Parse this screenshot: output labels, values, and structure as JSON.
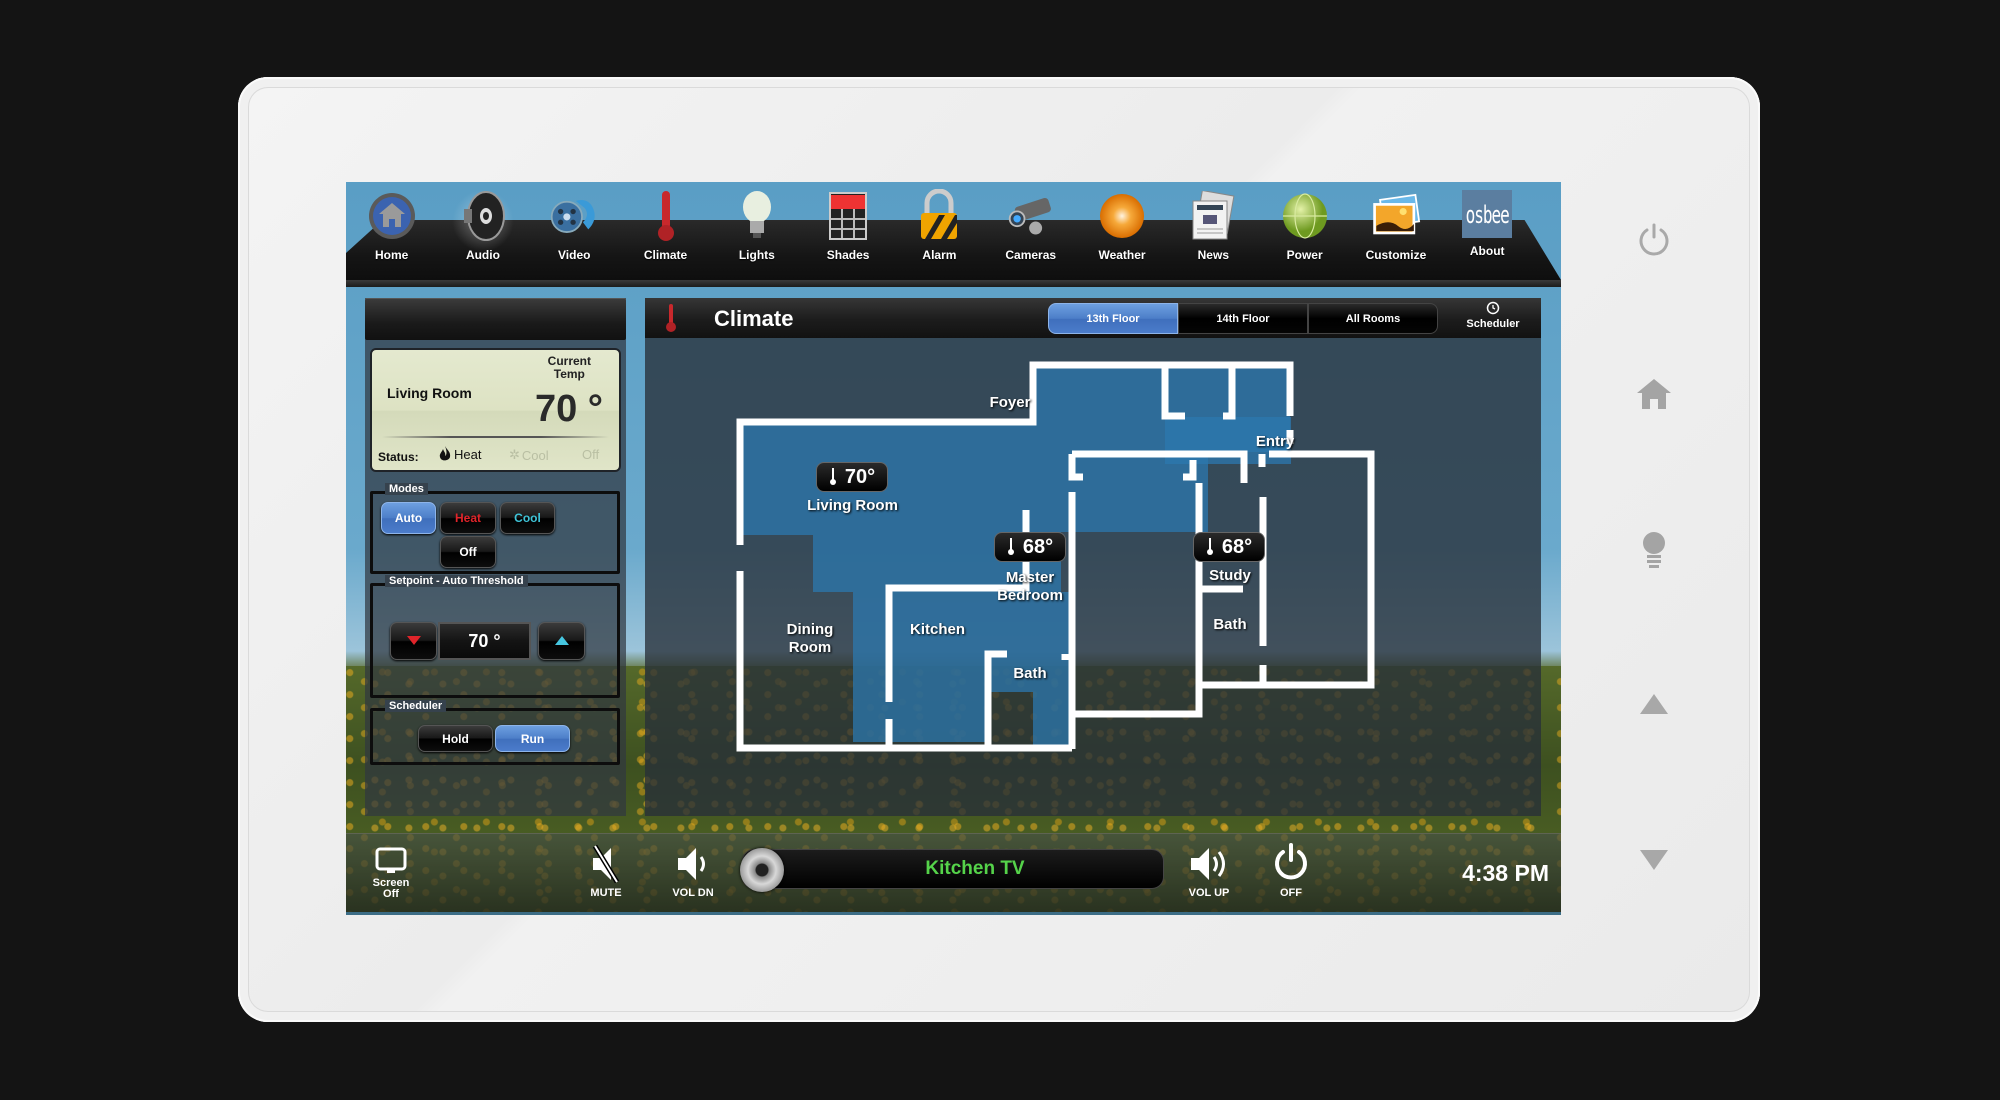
{
  "nav": {
    "items": [
      {
        "label": "Home",
        "icon": "home-icon"
      },
      {
        "label": "Audio",
        "icon": "speaker-icon"
      },
      {
        "label": "Video",
        "icon": "film-reel-icon"
      },
      {
        "label": "Climate",
        "icon": "thermometer-icon"
      },
      {
        "label": "Lights",
        "icon": "lightbulb-icon"
      },
      {
        "label": "Shades",
        "icon": "shades-icon"
      },
      {
        "label": "Alarm",
        "icon": "padlock-icon"
      },
      {
        "label": "Cameras",
        "icon": "security-camera-icon"
      },
      {
        "label": "Weather",
        "icon": "weather-sun-icon"
      },
      {
        "label": "News",
        "icon": "newspaper-icon"
      },
      {
        "label": "Power",
        "icon": "globe-icon"
      },
      {
        "label": "Customize",
        "icon": "photos-icon"
      },
      {
        "label": "About",
        "icon": "osbee-logo"
      }
    ],
    "active": "Audio",
    "logo_text": "osbee"
  },
  "thermostat": {
    "room": "Living Room",
    "current_temp_label_line1": "Current",
    "current_temp_label_line2": "Temp",
    "current_temp": "70 °",
    "status_label": "Status:",
    "status_options": [
      "Heat",
      "Cool",
      "Off"
    ],
    "status_active": "Heat"
  },
  "modes": {
    "title": "Modes",
    "buttons": [
      {
        "label": "Auto",
        "color": "#ffffff"
      },
      {
        "label": "Heat",
        "color": "#e0242a"
      },
      {
        "label": "Cool",
        "color": "#3fc4d8"
      },
      {
        "label": "Off",
        "color": "#ffffff"
      }
    ],
    "active": "Auto"
  },
  "setpoint": {
    "title": "Setpoint - Auto Threshold",
    "value": "70 °",
    "down_color": "#e0242a",
    "up_color": "#46c6e0"
  },
  "scheduler": {
    "title": "Scheduler",
    "buttons": [
      "Hold",
      "Run"
    ],
    "active": "Run"
  },
  "climate": {
    "title": "Climate",
    "floors": [
      "13th Floor",
      "14th Floor",
      "All Rooms"
    ],
    "active_floor": "13th Floor",
    "scheduler_label": "Scheduler",
    "rooms": [
      {
        "name": "Foyer"
      },
      {
        "name": "Entry"
      },
      {
        "name": "Living Room",
        "temp": "70°"
      },
      {
        "name": "Master Bedroom",
        "line1": "Master",
        "line2": "Bedroom",
        "temp": "68°"
      },
      {
        "name": "Study",
        "temp": "68°"
      },
      {
        "name": "Bath"
      },
      {
        "name": "Dining Room",
        "line1": "Dining",
        "line2": "Room"
      },
      {
        "name": "Kitchen"
      },
      {
        "name": "Bath"
      }
    ]
  },
  "bottom": {
    "screen_off_line1": "Screen",
    "screen_off_line2": "Off",
    "mute": "MUTE",
    "vol_dn": "VOL DN",
    "source": "Kitchen TV",
    "vol_up": "VOL UP",
    "off": "OFF",
    "time": "4:38 PM"
  },
  "side_buttons": [
    "power-icon",
    "home-icon",
    "lightbulb-icon",
    "arrow-up-icon",
    "arrow-down-icon"
  ]
}
